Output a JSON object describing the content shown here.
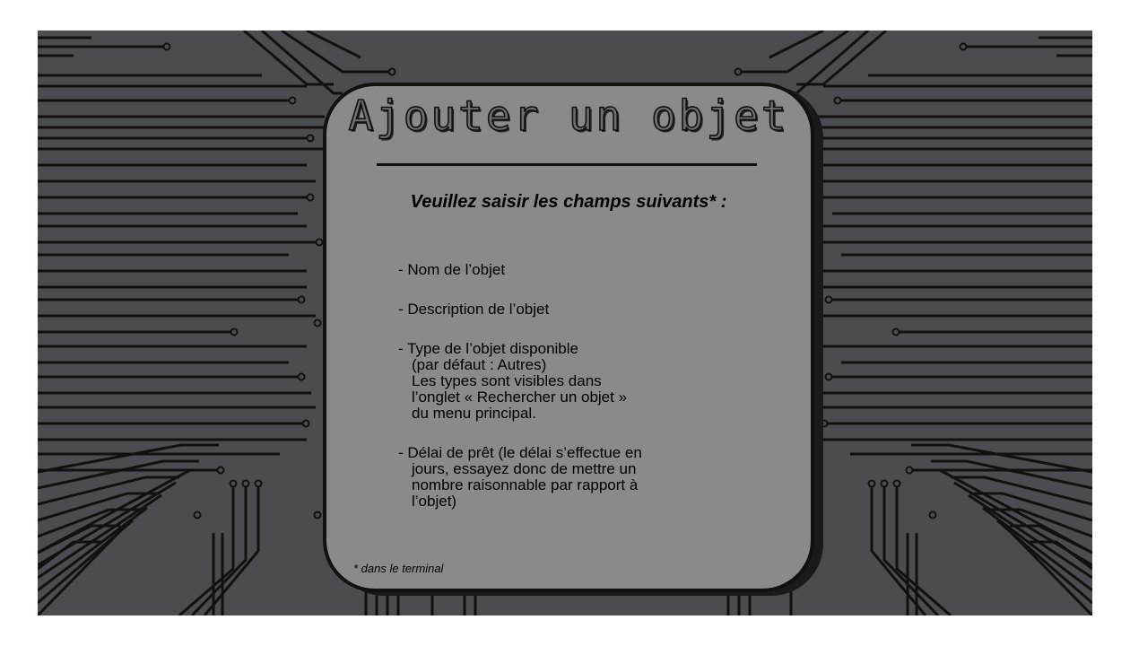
{
  "title": "Ajouter un objet",
  "subtitle": "Veuillez saisir les champs suivants* :",
  "fields": [
    {
      "head": "- Nom de l’objet",
      "body": []
    },
    {
      "head": "- Description de l’objet",
      "body": []
    },
    {
      "head": "- Type de l’objet disponible",
      "body": [
        "(par défaut : Autres)",
        "Les types sont visibles dans",
        "l’onglet « Rechercher un objet »",
        "du menu principal."
      ]
    },
    {
      "head": "- Délai de prêt (le délai s’effectue en",
      "body": [
        "jours, essayez donc de mettre un",
        "nombre raisonnable par rapport à",
        "l’objet)"
      ]
    }
  ],
  "footnote": "* dans le terminal",
  "colors": {
    "background": "#4a4c4f",
    "trace": "#111111",
    "panel": "#8a8a8a",
    "panel_border": "#111111"
  }
}
